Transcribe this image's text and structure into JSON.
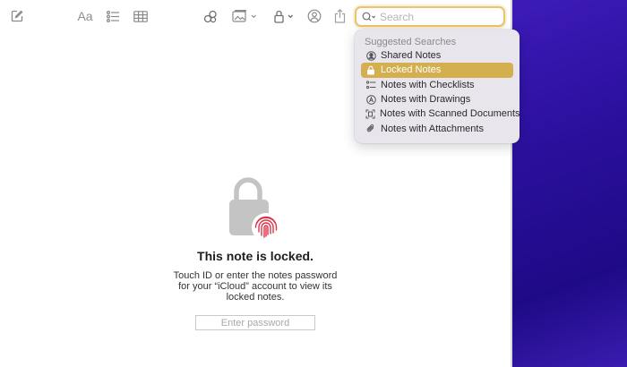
{
  "search": {
    "placeholder": "Search"
  },
  "suggestions": {
    "header": "Suggested Searches",
    "items": [
      {
        "label": "Shared Notes",
        "icon": "person-circle-icon",
        "selected": false
      },
      {
        "label": "Locked Notes",
        "icon": "lock-icon",
        "selected": true
      },
      {
        "label": "Notes with Checklists",
        "icon": "checklist-icon",
        "selected": false
      },
      {
        "label": "Notes with Drawings",
        "icon": "drawing-icon",
        "selected": false
      },
      {
        "label": "Notes with Scanned Documents",
        "icon": "scan-icon",
        "selected": false
      },
      {
        "label": "Notes with Attachments",
        "icon": "paperclip-icon",
        "selected": false
      }
    ]
  },
  "locked": {
    "title": "This note is locked.",
    "message": "Touch ID or enter the notes password for your “iCloud” account to view its locked notes.",
    "password_placeholder": "Enter password"
  },
  "toolbar": {
    "format_label": "Aa"
  },
  "colors": {
    "accent": "#e9c46a",
    "selected": "#d3af4f",
    "fingerprint": "#d8344a",
    "desktop": "#2a0f9c"
  }
}
